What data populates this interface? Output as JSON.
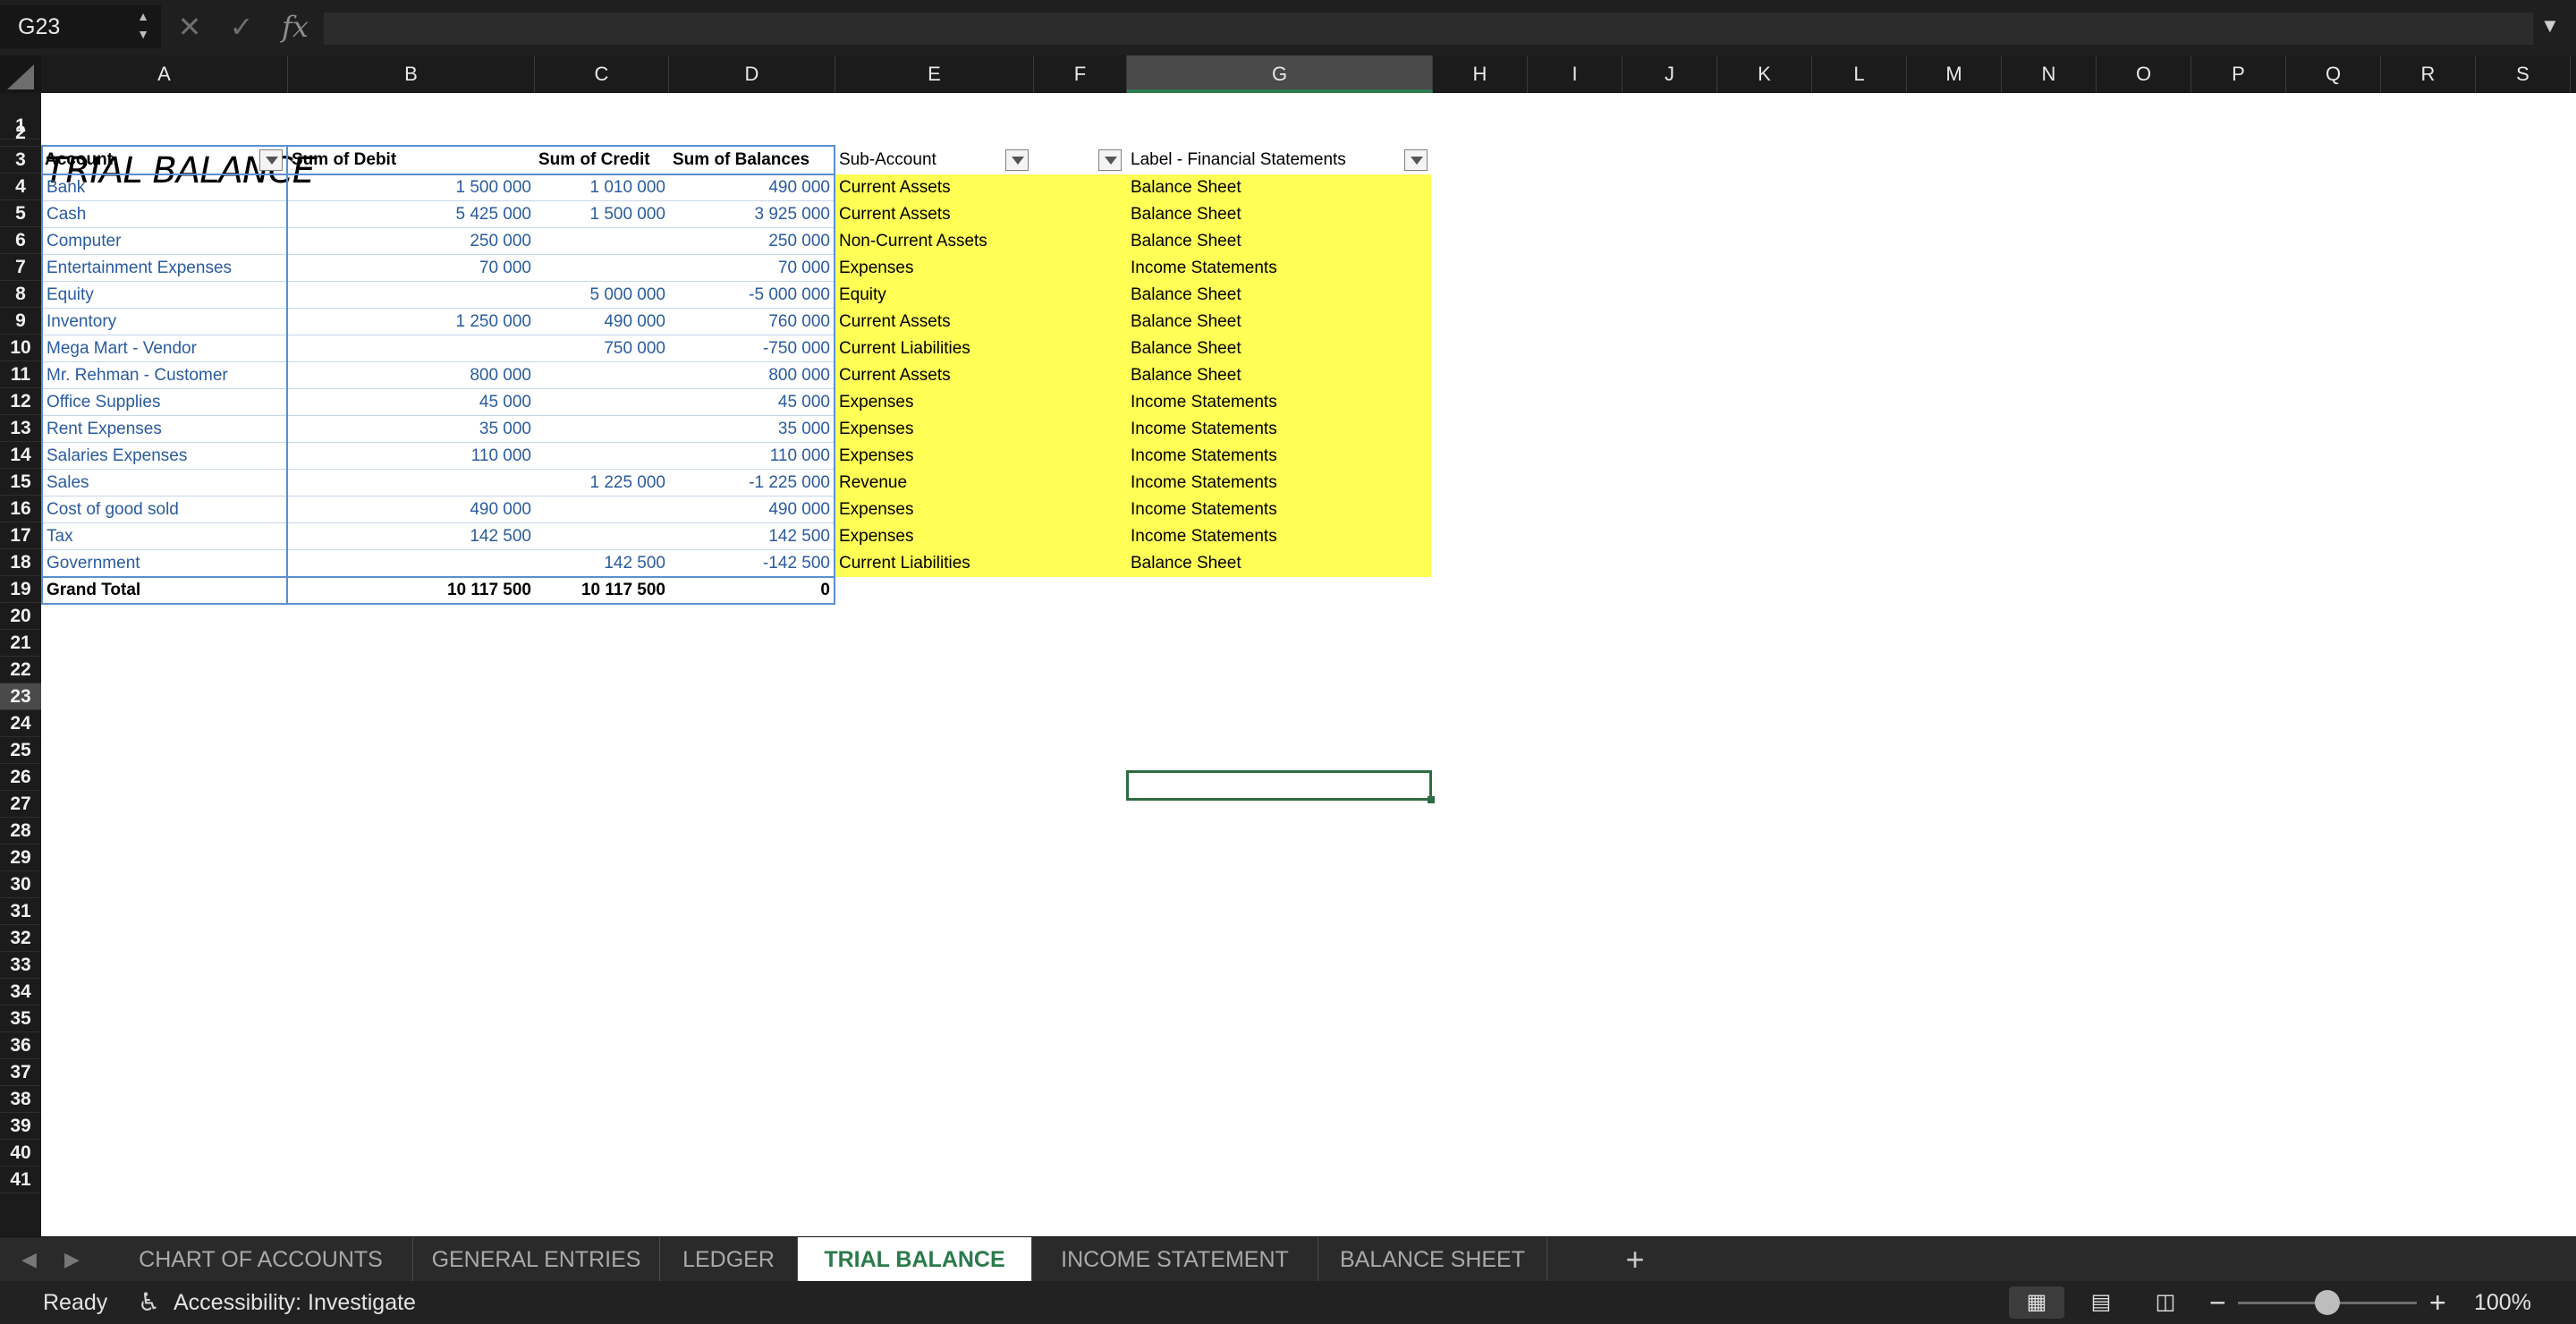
{
  "formula_bar": {
    "name_box": "G23",
    "formula": ""
  },
  "columns": [
    "A",
    "B",
    "C",
    "D",
    "E",
    "F",
    "G",
    "H",
    "I",
    "J",
    "K",
    "L",
    "M",
    "N",
    "O",
    "P",
    "Q",
    "R",
    "S"
  ],
  "active_column": "G",
  "active_row": 23,
  "row_count": 41,
  "sheet_title": "TRIAL BALANCE",
  "table_headers": {
    "account": "Account",
    "debit": "Sum of Debit",
    "credit": "Sum of Credit",
    "balances": "Sum of Balances",
    "sub_account": "Sub-Account",
    "label": "Label - Financial Statements"
  },
  "rows": [
    {
      "account": "Bank",
      "debit": "1 500 000",
      "credit": "1 010 000",
      "balance": "490 000",
      "sub": "Current Assets",
      "label": "Balance Sheet"
    },
    {
      "account": "Cash",
      "debit": "5 425 000",
      "credit": "1 500 000",
      "balance": "3 925 000",
      "sub": "Current Assets",
      "label": "Balance Sheet"
    },
    {
      "account": "Computer",
      "debit": "250 000",
      "credit": "",
      "balance": "250 000",
      "sub": "Non-Current Assets",
      "label": "Balance Sheet"
    },
    {
      "account": "Entertainment Expenses",
      "debit": "70 000",
      "credit": "",
      "balance": "70 000",
      "sub": "Expenses",
      "label": "Income Statements"
    },
    {
      "account": "Equity",
      "debit": "",
      "credit": "5 000 000",
      "balance": "-5 000 000",
      "sub": "Equity",
      "label": "Balance Sheet"
    },
    {
      "account": "Inventory",
      "debit": "1 250 000",
      "credit": "490 000",
      "balance": "760 000",
      "sub": "Current Assets",
      "label": "Balance Sheet"
    },
    {
      "account": "Mega Mart - Vendor",
      "debit": "",
      "credit": "750 000",
      "balance": "-750 000",
      "sub": "Current Liabilities",
      "label": "Balance Sheet"
    },
    {
      "account": "Mr. Rehman - Customer",
      "debit": "800 000",
      "credit": "",
      "balance": "800 000",
      "sub": "Current Assets",
      "label": "Balance Sheet"
    },
    {
      "account": "Office Supplies",
      "debit": "45 000",
      "credit": "",
      "balance": "45 000",
      "sub": "Expenses",
      "label": "Income Statements"
    },
    {
      "account": "Rent Expenses",
      "debit": "35 000",
      "credit": "",
      "balance": "35 000",
      "sub": "Expenses",
      "label": "Income Statements"
    },
    {
      "account": "Salaries Expenses",
      "debit": "110 000",
      "credit": "",
      "balance": "110 000",
      "sub": "Expenses",
      "label": "Income Statements"
    },
    {
      "account": "Sales",
      "debit": "",
      "credit": "1 225 000",
      "balance": "-1 225 000",
      "sub": "Revenue",
      "label": "Income Statements"
    },
    {
      "account": "Cost of good sold",
      "debit": "490 000",
      "credit": "",
      "balance": "490 000",
      "sub": "Expenses",
      "label": "Income Statements"
    },
    {
      "account": "Tax",
      "debit": "142 500",
      "credit": "",
      "balance": "142 500",
      "sub": "Expenses",
      "label": "Income Statements"
    },
    {
      "account": "Government",
      "debit": "",
      "credit": "142 500",
      "balance": "-142 500",
      "sub": "Current Liabilities",
      "label": "Balance Sheet"
    }
  ],
  "grand_total": {
    "label": "Grand Total",
    "debit": "10 117 500",
    "credit": "10 117 500",
    "balance": "0"
  },
  "sheet_tabs": [
    {
      "label": "CHART OF ACCOUNTS",
      "active": false
    },
    {
      "label": "GENERAL ENTRIES",
      "active": false
    },
    {
      "label": "LEDGER",
      "active": false
    },
    {
      "label": "TRIAL BALANCE",
      "active": true
    },
    {
      "label": "INCOME STATEMENT",
      "active": false
    },
    {
      "label": "BALANCE SHEET",
      "active": false
    }
  ],
  "add_sheet_label": "+",
  "status": {
    "ready": "Ready",
    "accessibility": "Accessibility: Investigate",
    "zoom": "100%"
  },
  "colors": {
    "accent": "#2b7a4b",
    "highlight": "#ffff55",
    "pivot_text": "#2a5b9f"
  }
}
